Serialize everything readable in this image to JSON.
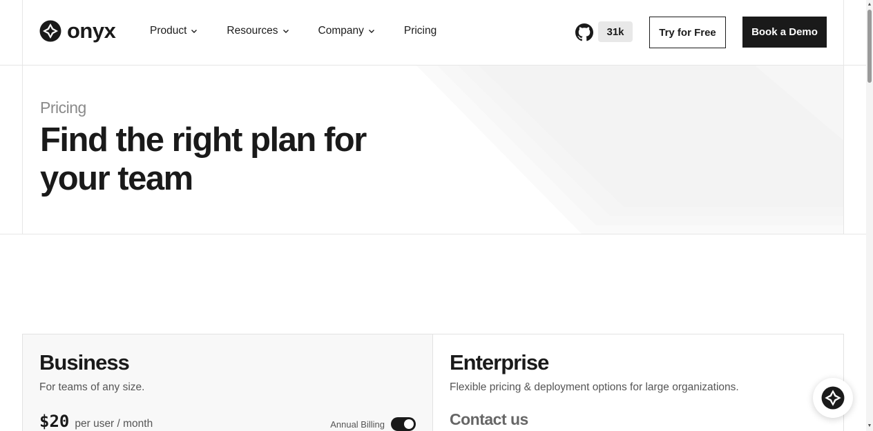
{
  "header": {
    "logo_text": "onyx",
    "nav": [
      {
        "label": "Product",
        "has_dropdown": true
      },
      {
        "label": "Resources",
        "has_dropdown": true
      },
      {
        "label": "Company",
        "has_dropdown": true
      },
      {
        "label": "Pricing",
        "has_dropdown": false
      }
    ],
    "github_icon": "github-icon",
    "github_stars": "31k",
    "try_label": "Try for Free",
    "demo_label": "Book a Demo"
  },
  "hero": {
    "eyebrow": "Pricing",
    "title_line1": "Find the right plan for",
    "title_line2": "your team"
  },
  "plans": {
    "business": {
      "name": "Business",
      "description": "For teams of any size.",
      "price": "$20",
      "price_unit": "per user / month",
      "billing_label": "Annual Billing",
      "annual_billing_on": true
    },
    "enterprise": {
      "name": "Enterprise",
      "description": "Flexible pricing & deployment options for large organizations.",
      "cta": "Contact us"
    }
  },
  "chat": {
    "icon": "onyx-logo-icon"
  },
  "colors": {
    "primary": "#1a1a1a",
    "muted": "#8a8a8a",
    "border": "#e6e6e6",
    "stars_bg": "#e8e8e8"
  }
}
